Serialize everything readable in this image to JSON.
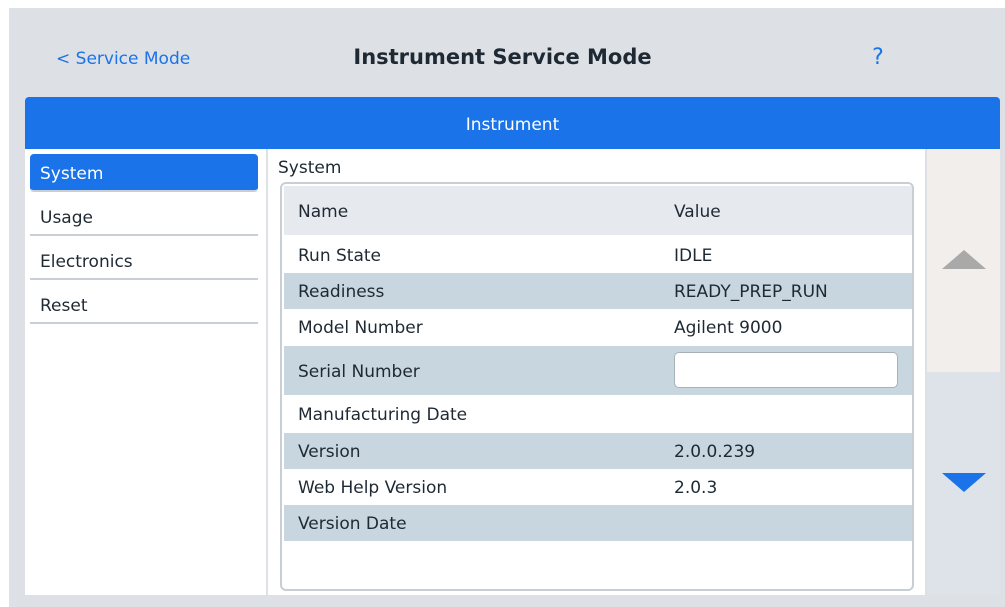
{
  "header": {
    "back_label": "< Service Mode",
    "title": "Instrument Service Mode",
    "help": "?"
  },
  "section_bar": {
    "label": "Instrument"
  },
  "nav": {
    "items": [
      {
        "label": "System",
        "active": true
      },
      {
        "label": "Usage",
        "active": false
      },
      {
        "label": "Electronics",
        "active": false
      },
      {
        "label": "Reset",
        "active": false
      }
    ]
  },
  "main": {
    "heading": "System",
    "columns": {
      "name": "Name",
      "value": "Value"
    },
    "rows": [
      {
        "name": "Run State",
        "value": "IDLE"
      },
      {
        "name": "Readiness",
        "value": "READY_PREP_RUN"
      },
      {
        "name": "Model Number",
        "value": "Agilent 9000"
      },
      {
        "name": "Serial Number",
        "value": ""
      },
      {
        "name": "Manufacturing Date",
        "value": ""
      },
      {
        "name": "Version",
        "value": "2.0.0.239"
      },
      {
        "name": "Web Help Version",
        "value": "2.0.3"
      },
      {
        "name": "Version Date",
        "value": ""
      }
    ]
  },
  "scroll": {
    "up_icon": "triangle-up-icon",
    "down_icon": "triangle-down-icon"
  },
  "colors": {
    "accent": "#1a73e8",
    "row_shade": "#c7d6df",
    "background": "#dde1e5"
  }
}
